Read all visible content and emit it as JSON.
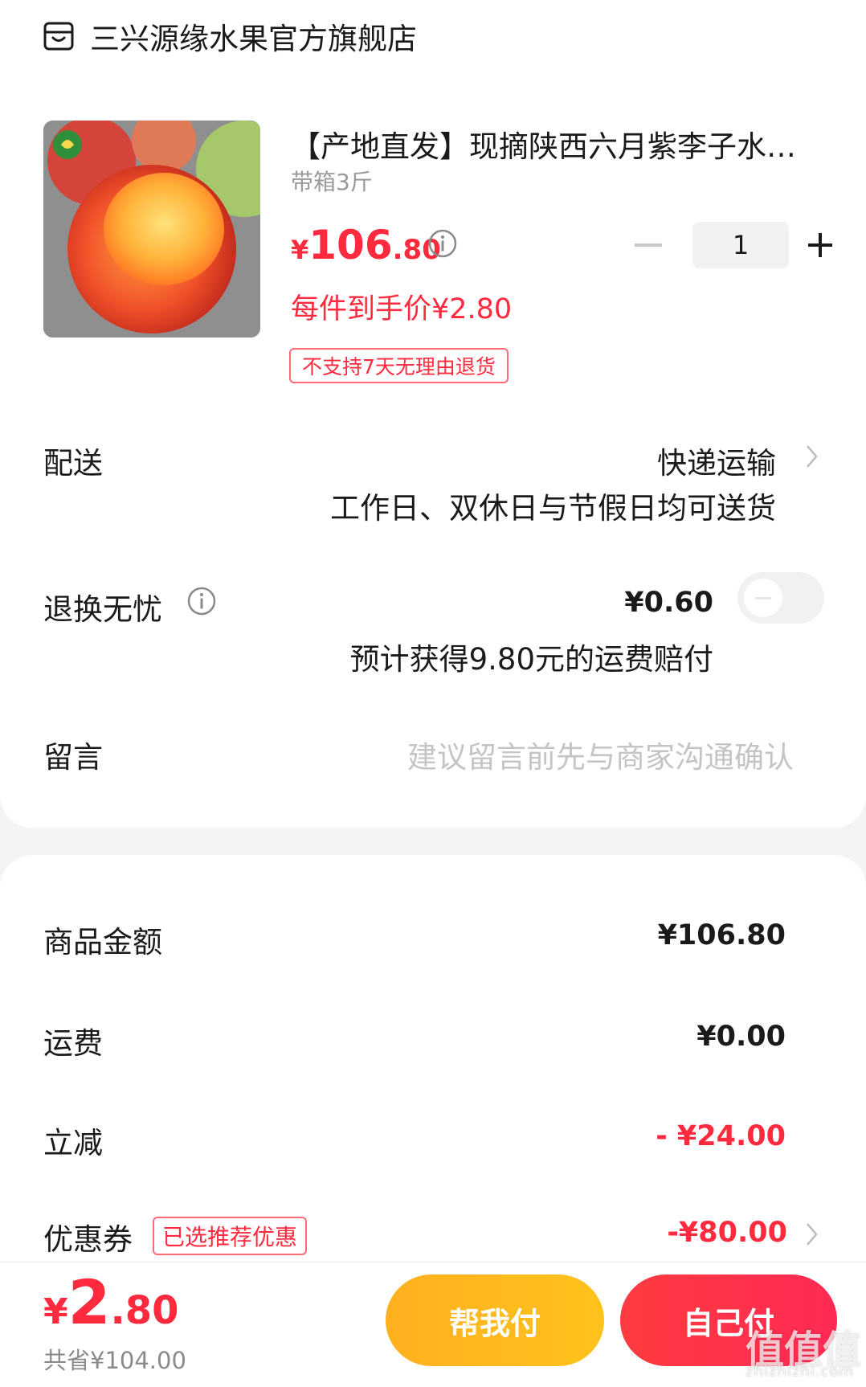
{
  "store": {
    "name": "三兴源缘水果官方旗舰店",
    "icon": "store-icon"
  },
  "product": {
    "title": "【产地直发】现摘陕西六月紫李子水…",
    "spec": "带箱3斤",
    "price_symbol": "¥",
    "price_int": "106",
    "price_dec": ".80",
    "unit_price": "每件到手价¥2.80",
    "return_policy": "不支持7天无理由退货",
    "quantity": "1"
  },
  "delivery": {
    "label": "配送",
    "method": "快递运输",
    "note": "工作日、双休日与节假日均可送货"
  },
  "return_insurance": {
    "label": "退换无忧",
    "price": "¥0.60",
    "note": "预计获得9.80元的运费赔付",
    "enabled": false
  },
  "message": {
    "label": "留言",
    "placeholder": "建议留言前先与商家沟通确认"
  },
  "summary": {
    "goods_label": "商品金额",
    "goods_value": "¥106.80",
    "shipping_label": "运费",
    "shipping_value": "¥0.00",
    "discount_label": "立减",
    "discount_value": "- ¥24.00",
    "coupon_label": "优惠券",
    "coupon_tag": "已选推荐优惠",
    "coupon_value": "-¥80.00"
  },
  "footer": {
    "total_symbol": "¥",
    "total_int": "2",
    "total_dec": ".80",
    "saved": "共省¥104.00",
    "help_pay": "帮我付",
    "self_pay": "自己付",
    "watermark": "值值值",
    "watermark_url": "zhizhizhi.com"
  },
  "colors": {
    "accent_red": "#ff2a3d",
    "help_btn": "#ffb01f",
    "self_btn": "#ff3b3f"
  }
}
